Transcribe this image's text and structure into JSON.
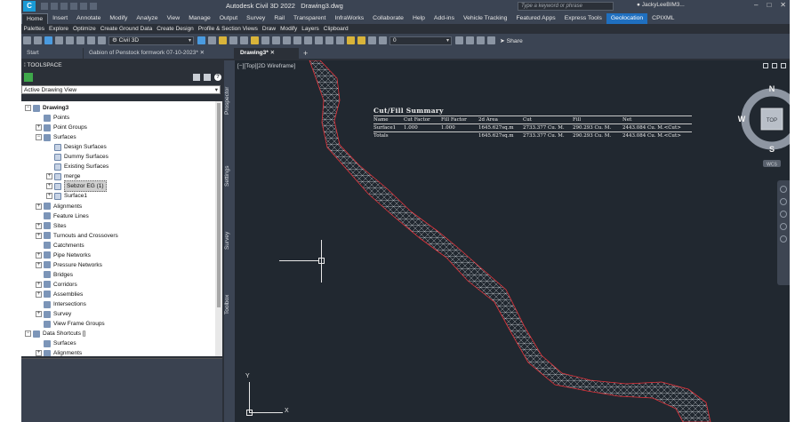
{
  "titlebar": {
    "app_title": "Autodesk Civil 3D 2022",
    "file_name": "Drawing3.dwg",
    "search_placeholder": "Type a keyword or phrase",
    "user": "JackyLeeBIM3..."
  },
  "ribbon_tabs": [
    "Home",
    "Insert",
    "Annotate",
    "Modify",
    "Analyze",
    "View",
    "Manage",
    "Output",
    "Survey",
    "Rail",
    "Transparent",
    "InfraWorks",
    "Collaborate",
    "Help",
    "Add-ins",
    "Vehicle Tracking",
    "Featured Apps",
    "Express Tools",
    "Geolocation",
    "CPIXML"
  ],
  "panel_labels": [
    "Palettes",
    "Explore",
    "Optimize",
    "Create Ground Data",
    "Create Design",
    "Profile & Section Views",
    "Draw",
    "Modify",
    "Layers",
    "Clipboard"
  ],
  "toolbar": {
    "workspace": "Civil 3D",
    "layer_value": "0",
    "share_label": "Share"
  },
  "doc_tabs": {
    "start": "Start",
    "gabion": "Gabion of Penstock formwork  07-10-2023*",
    "drawing3": "Drawing3*"
  },
  "toolspace": {
    "title": "TOOLSPACE",
    "view_select": "Active Drawing View",
    "tree": [
      {
        "label": "Drawing3",
        "level": 0,
        "exp": "−",
        "bold": true
      },
      {
        "label": "Points",
        "level": 1,
        "exp": ""
      },
      {
        "label": "Point Groups",
        "level": 1,
        "exp": "+"
      },
      {
        "label": "Surfaces",
        "level": 1,
        "exp": "−"
      },
      {
        "label": "Design Surfaces",
        "level": 2,
        "exp": ""
      },
      {
        "label": "Dummy Surfaces",
        "level": 2,
        "exp": ""
      },
      {
        "label": "Existing Surfaces",
        "level": 2,
        "exp": ""
      },
      {
        "label": "merge",
        "level": 2,
        "exp": "+"
      },
      {
        "label": "Sebzor EG (1)",
        "level": 2,
        "exp": "+",
        "selected": true
      },
      {
        "label": "Surface1",
        "level": 2,
        "exp": "+"
      },
      {
        "label": "Alignments",
        "level": 1,
        "exp": "+"
      },
      {
        "label": "Feature Lines",
        "level": 1,
        "exp": ""
      },
      {
        "label": "Sites",
        "level": 1,
        "exp": "+"
      },
      {
        "label": "Turnouts and Crossovers",
        "level": 1,
        "exp": "+"
      },
      {
        "label": "Catchments",
        "level": 1,
        "exp": ""
      },
      {
        "label": "Pipe Networks",
        "level": 1,
        "exp": "+"
      },
      {
        "label": "Pressure Networks",
        "level": 1,
        "exp": "+"
      },
      {
        "label": "Bridges",
        "level": 1,
        "exp": ""
      },
      {
        "label": "Corridors",
        "level": 1,
        "exp": "+"
      },
      {
        "label": "Assemblies",
        "level": 1,
        "exp": "+"
      },
      {
        "label": "Intersections",
        "level": 1,
        "exp": ""
      },
      {
        "label": "Survey",
        "level": 1,
        "exp": "+"
      },
      {
        "label": "View Frame Groups",
        "level": 1,
        "exp": ""
      },
      {
        "label": "Data Shortcuts []",
        "level": 0,
        "exp": "−"
      },
      {
        "label": "Surfaces",
        "level": 1,
        "exp": ""
      },
      {
        "label": "Alignments",
        "level": 1,
        "exp": "+"
      }
    ]
  },
  "side_tabs": [
    "Prospector",
    "Settings",
    "Survey",
    "Toolbox"
  ],
  "canvas": {
    "view_label": "[−][Top][2D Wireframe]",
    "ucs_x": "X",
    "ucs_y": "Y"
  },
  "viewcube": {
    "north": "N",
    "south": "S",
    "east": "E",
    "west": "W",
    "face": "TOP",
    "wcs": "WCS"
  },
  "cut_fill": {
    "title": "Cut/Fill Summary",
    "headers": [
      "Name",
      "Cut Factor",
      "Fill Factor",
      "2d Area",
      "Cut",
      "Fill",
      "Net"
    ],
    "rows": [
      [
        "Surface1",
        "1.000",
        "1.000",
        "1645.627sq.m",
        "2733.377 Cu. M.",
        "290.293 Cu. M.",
        "2443.084 Cu. M.<Cut>"
      ]
    ],
    "totals": [
      "Totals",
      "",
      "",
      "1645.627sq.m",
      "2733.377 Cu. M.",
      "290.293 Cu. M.",
      "2443.084 Cu. M.<Cut>"
    ]
  },
  "colors": {
    "surface_outline": "#e8323a",
    "tin_mesh": "#d8dde3",
    "geolocation_tab": "#1f6fbf"
  }
}
